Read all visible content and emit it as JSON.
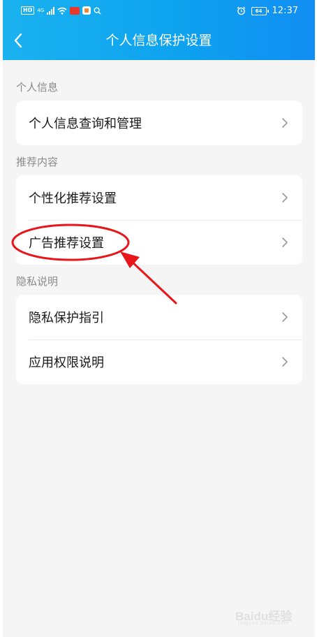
{
  "status_bar": {
    "hd": "HD",
    "network": "4G",
    "battery": "64",
    "time": "12:37"
  },
  "header": {
    "title": "个人信息保护设置"
  },
  "sections": [
    {
      "label": "个人信息",
      "items": [
        {
          "label": "个人信息查询和管理"
        }
      ]
    },
    {
      "label": "推荐内容",
      "items": [
        {
          "label": "个性化推荐设置"
        },
        {
          "label": "广告推荐设置"
        }
      ]
    },
    {
      "label": "隐私说明",
      "items": [
        {
          "label": "隐私保护指引"
        },
        {
          "label": "应用权限说明"
        }
      ]
    }
  ],
  "watermark": {
    "brand": "Baidu经验",
    "sub": "jingyan.baidu.com"
  },
  "colors": {
    "header_gradient_start": "#1ab2f0",
    "header_gradient_end": "#118ef3",
    "annotation_red": "#e8161b"
  }
}
